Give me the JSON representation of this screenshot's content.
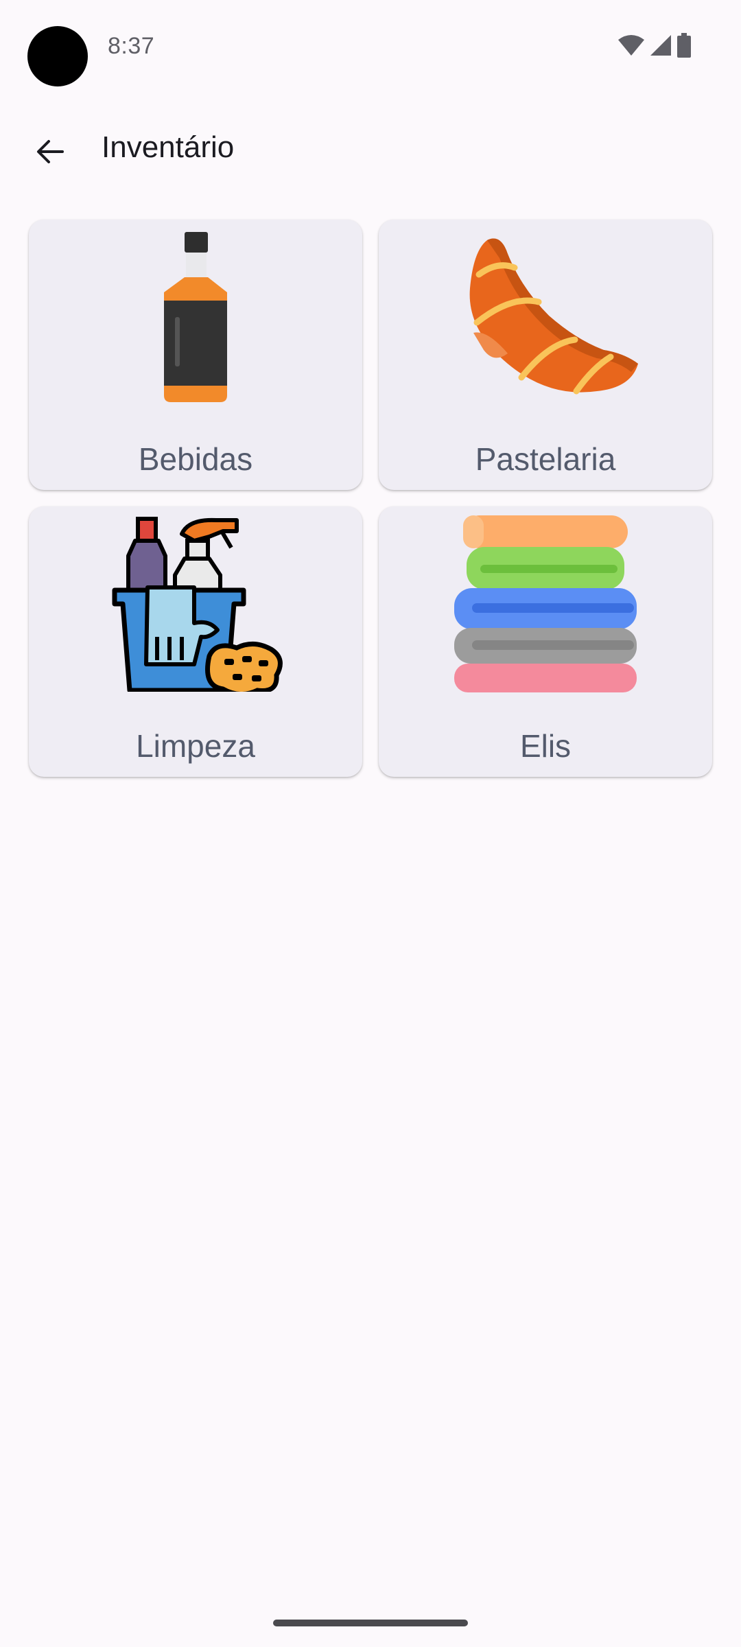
{
  "status": {
    "time": "8:37",
    "icons": [
      "wifi-icon",
      "signal-icon",
      "battery-icon"
    ]
  },
  "app_bar": {
    "title": "Inventário",
    "back_icon": "arrow-back-icon"
  },
  "categories": [
    {
      "label": "Bebidas",
      "icon": "bottle-icon"
    },
    {
      "label": "Pastelaria",
      "icon": "croissant-icon"
    },
    {
      "label": "Limpeza",
      "icon": "cleaning-supplies-icon"
    },
    {
      "label": "Elis",
      "icon": "towels-stack-icon"
    }
  ],
  "colors": {
    "background": "#fcf9fc",
    "card": "#efedf4",
    "label": "#535a6c",
    "title": "#1b1b21"
  }
}
